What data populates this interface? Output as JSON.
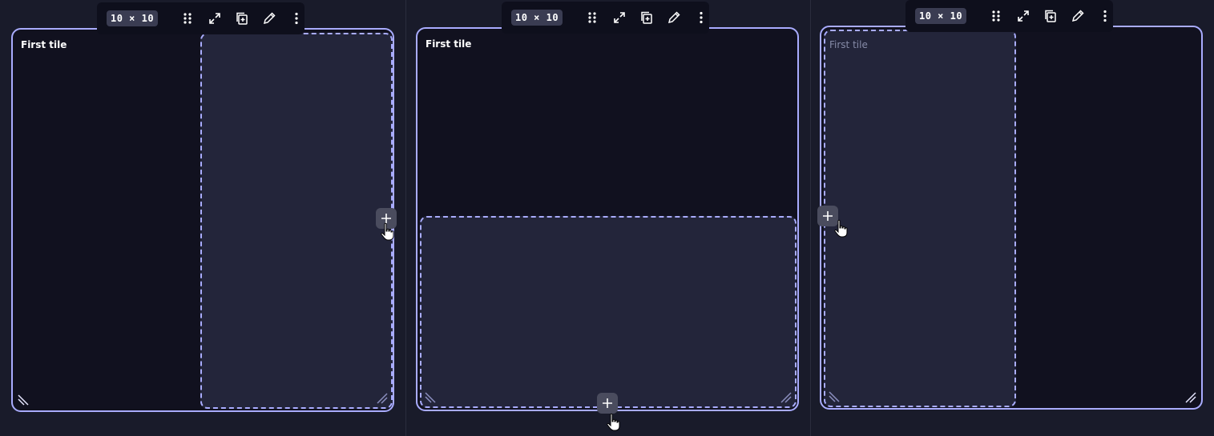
{
  "panels": [
    {
      "tile_title": "First tile",
      "size_label": "10 × 10",
      "dropzone_side": "right"
    },
    {
      "tile_title": "First tile",
      "size_label": "10 × 10",
      "dropzone_side": "bottom"
    },
    {
      "tile_title": "First tile",
      "size_label": "10 × 10",
      "dropzone_side": "left"
    }
  ],
  "toolbar_icons": [
    "drag-handle-icon",
    "expand-icon",
    "duplicate-icon",
    "edit-pencil-icon",
    "more-vertical-icon"
  ],
  "colors": {
    "background": "#191b2a",
    "tile_background": "#11111f",
    "tile_border": "#a9acff",
    "dropzone_background": "#23253a",
    "toolbar_background": "#0e0f1c"
  }
}
